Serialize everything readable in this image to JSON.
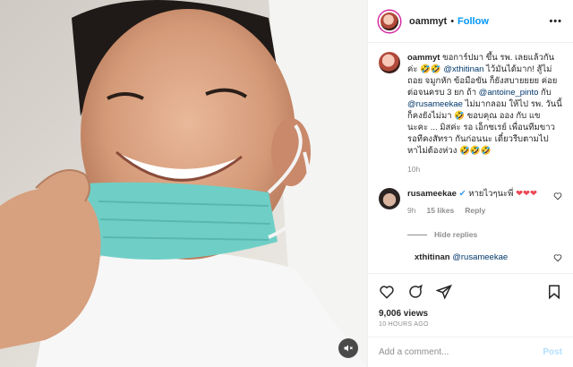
{
  "header": {
    "username": "oammyt",
    "separator": "•",
    "follow_label": "Follow",
    "more_label": "•••"
  },
  "caption": {
    "username": "oammyt",
    "text_1": "ขอการ์ปมา ขึ้น รพ. เลยแล้วกันค่ะ 🤣🤣",
    "mention_1": "@xthitinan",
    "text_2": "ไว้มันได้มาก! สู้ไม่ถอย จมูกหัก ข้อมือขัน ก็ยังสบายยยย ค่อยต่อจนครบ 3 ยก ถ้า",
    "mention_2": "@antoine_pinto",
    "text_3": "กับ",
    "mention_3": "@rusameekae",
    "text_4": "ไม่มากลอม ให้ไป รพ. วันนี้ก็คงยังไม่มา 🤣 ขอบคุณ ออง กับ แข นะคะ ... มิสค่ะ รอ เอ็กซเรย์ เพื่อนทีมขาวรอทีคงสัทรา กันก่อนนะ เดี๋ยวรีบตามไปหาไม่ต้องห่วง 🤣🤣🤣",
    "time": "10h"
  },
  "comment": {
    "username": "rusameekae",
    "verified": "✔",
    "text": "หายไวๆนะพี่",
    "hearts": "❤❤❤",
    "time": "9h",
    "likes": "15 likes",
    "reply_label": "Reply",
    "hide_replies": "Hide replies"
  },
  "reply": {
    "username": "xthitinan",
    "mention": "@rusameekae"
  },
  "stats": {
    "likes": "9,006 views",
    "ago": "10 HOURS AGO"
  },
  "add_comment": {
    "placeholder": "Add a comment...",
    "post_label": "Post"
  },
  "icons": {
    "like": "heart-icon",
    "comment": "comment-icon",
    "share": "send-icon",
    "save": "bookmark-icon",
    "audio": "speaker-muted-icon"
  },
  "colors": {
    "follow": "#0095f6",
    "mention": "#00376b",
    "heart": "#ed4956",
    "verified": "#3897f0"
  }
}
